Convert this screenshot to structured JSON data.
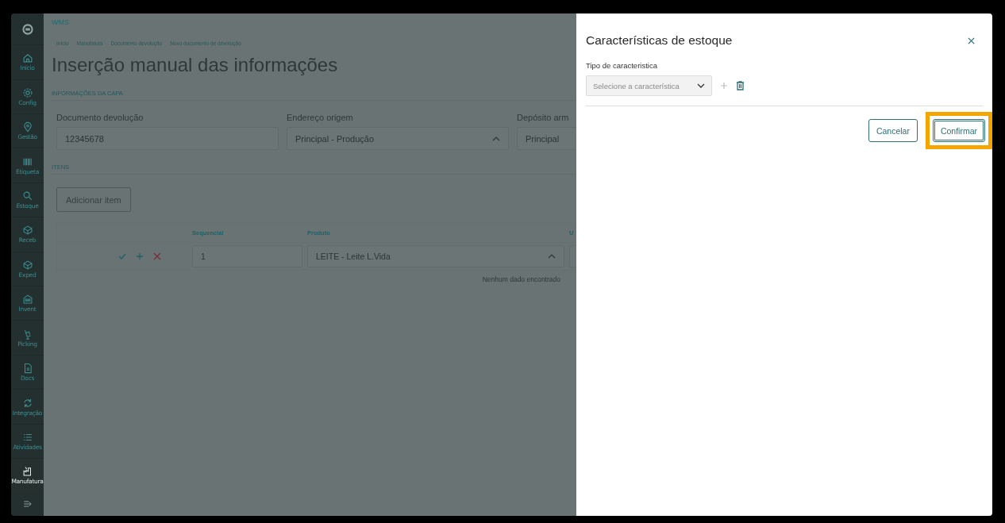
{
  "sidebar": {
    "items": [
      {
        "label": "Início",
        "selected": false
      },
      {
        "label": "Config",
        "selected": false
      },
      {
        "label": "Gestão",
        "selected": false
      },
      {
        "label": "Etiqueta",
        "selected": false
      },
      {
        "label": "Estoque",
        "selected": false
      },
      {
        "label": "Receb",
        "selected": false
      },
      {
        "label": "Exped",
        "selected": false
      },
      {
        "label": "Invent",
        "selected": false
      },
      {
        "label": "Picking",
        "selected": false
      },
      {
        "label": "Docs",
        "selected": false
      },
      {
        "label": "Integração",
        "selected": false
      },
      {
        "label": "Atividades",
        "selected": false
      },
      {
        "label": "Manufatura",
        "selected": true
      }
    ]
  },
  "main": {
    "app_name": "WMS",
    "breadcrumbs": [
      "Início",
      "Manufatura",
      "Documento devolução",
      "Novo documento de devolução"
    ],
    "title": "Inserção manual das informações",
    "cover_section": {
      "heading": "INFORMAÇÕES DA CAPA",
      "fields": [
        {
          "kind": "text",
          "label": "Documento devolução",
          "value": "12345678"
        },
        {
          "kind": "select",
          "label": "Endereço origem",
          "value": "Principal - Produção"
        },
        {
          "kind": "text",
          "label": "Depósito arm",
          "value": "Principal"
        }
      ]
    },
    "items_section": {
      "heading": "ITENS",
      "add_button": {
        "label": "Adicionar item",
        "disabled": true
      },
      "table": {
        "columns": [
          "Sequencial",
          "Produto",
          "U"
        ],
        "rows": [
          {
            "sequencial": "1",
            "produto": "LEITE - Leite L.Vida"
          }
        ],
        "empty_message": "Nenhum dado encontrado"
      }
    }
  },
  "drawer": {
    "title": "Características de estoque",
    "field_label": "Tipo de caracteristica",
    "select_placeholder": "Selecione a característica",
    "add_disabled": true,
    "buttons": [
      {
        "kind": "secondary",
        "label": "Cancelar",
        "highlighted": false
      },
      {
        "kind": "primary",
        "label": "Confirmar",
        "highlighted": true
      }
    ]
  }
}
